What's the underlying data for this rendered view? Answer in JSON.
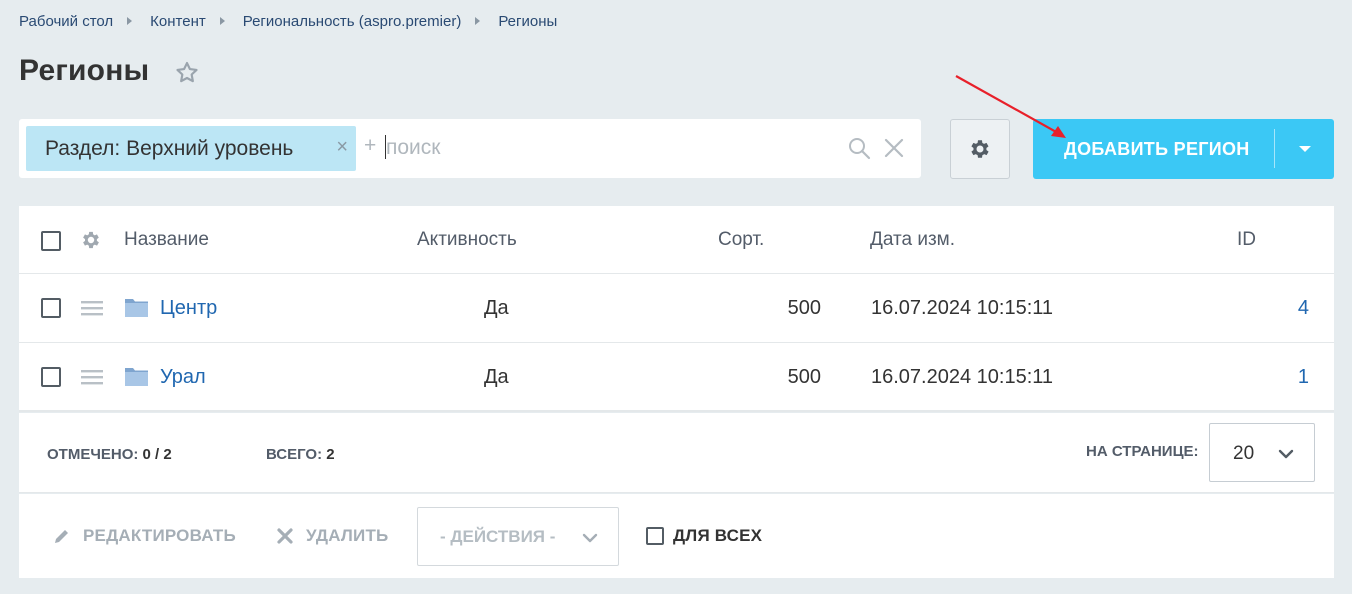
{
  "breadcrumb": [
    {
      "label": "Рабочий стол"
    },
    {
      "label": "Контент"
    },
    {
      "label": "Региональность (aspro.premier)"
    },
    {
      "label": "Регионы"
    }
  ],
  "page": {
    "title": "Регионы"
  },
  "filter": {
    "chip_label": "Раздел: Верхний уровень",
    "chip_close": "×",
    "plus": "+",
    "search_placeholder": "поиск",
    "search_value": ""
  },
  "toolbar": {
    "add_label": "ДОБАВИТЬ РЕГИОН"
  },
  "grid": {
    "columns": {
      "name": "Название",
      "active": "Активность",
      "sort": "Сорт.",
      "date": "Дата изм.",
      "id": "ID"
    },
    "rows": [
      {
        "name": "Центр",
        "active": "Да",
        "sort": "500",
        "date": "16.07.2024 10:15:11",
        "id": "4"
      },
      {
        "name": "Урал",
        "active": "Да",
        "sort": "500",
        "date": "16.07.2024 10:15:11",
        "id": "1"
      }
    ]
  },
  "footer": {
    "selected_label": "ОТМЕЧЕНО:",
    "selected_value": "0 / 2",
    "total_label": "ВСЕГО:",
    "total_value": "2",
    "per_page_label": "НА СТРАНИЦЕ:",
    "per_page_value": "20"
  },
  "actions": {
    "edit_label": "РЕДАКТИРОВАТЬ",
    "delete_label": "УДАЛИТЬ",
    "actions_placeholder": "- ДЕЙСТВИЯ -",
    "for_all_label": "ДЛЯ ВСЕХ"
  },
  "colors": {
    "accent": "#3bc8f5",
    "link": "#2067b0",
    "page_bg": "#e6ecef",
    "annotation_arrow": "#e8202a"
  }
}
